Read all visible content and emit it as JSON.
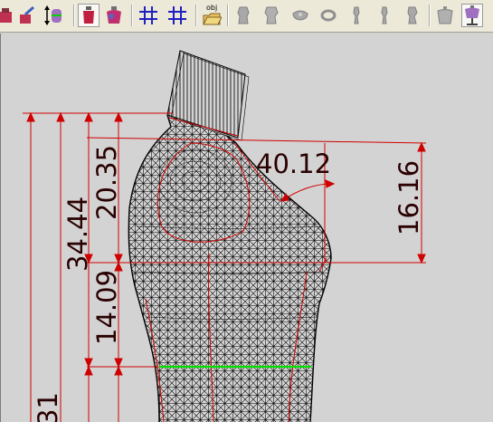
{
  "toolbar": {
    "buttons": [
      {
        "icon": "garment-front-icon"
      },
      {
        "icon": "paint-garment-icon"
      },
      {
        "icon": "height-adjust-icon"
      },
      {
        "icon": "mannequin-red-icon"
      },
      {
        "icon": "mannequin-color-icon"
      },
      {
        "icon": "grid-icon"
      },
      {
        "icon": "grid-measure-icon"
      },
      {
        "icon": "open-obj-icon",
        "label": "obj"
      },
      {
        "icon": "body-front-icon"
      },
      {
        "icon": "body-back-icon"
      },
      {
        "icon": "body-top-icon"
      },
      {
        "icon": "body-bottom-icon"
      },
      {
        "icon": "body-side-left-icon"
      },
      {
        "icon": "body-side-right-icon"
      },
      {
        "icon": "body-three-quarter-icon"
      },
      {
        "icon": "torso-icon"
      },
      {
        "icon": "torso-stand-icon"
      }
    ]
  },
  "measurements": {
    "angle": "40.12",
    "bust_depth": "16.16",
    "neck_to_bust": "20.35",
    "neck_to_waist": "34.44",
    "bust_to_waist": "14.09",
    "total_partial": "31"
  },
  "colors": {
    "measure_line": "#d00000",
    "waist_line": "#00e000",
    "mesh": "#000000",
    "background": "#d3d3d3"
  }
}
